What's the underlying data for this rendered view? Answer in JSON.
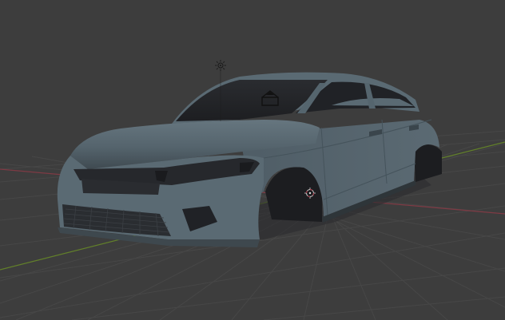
{
  "viewport": {
    "mode": "3D viewport",
    "shading": "solid",
    "background_color": "#3d3d3d",
    "grid_color": "#4a4a4a",
    "x_axis_color": "#8a3b45",
    "y_axis_color": "#6b8a2a",
    "model_body_color": "#52626b",
    "model_dark_color": "#1e1f22"
  },
  "scene_objects": [
    {
      "name": "car-body",
      "icon": "mesh"
    },
    {
      "name": "light",
      "icon": "sun-icon"
    },
    {
      "name": "camera",
      "icon": "camera-icon"
    },
    {
      "name": "origin",
      "icon": "origin-marker-icon"
    }
  ]
}
